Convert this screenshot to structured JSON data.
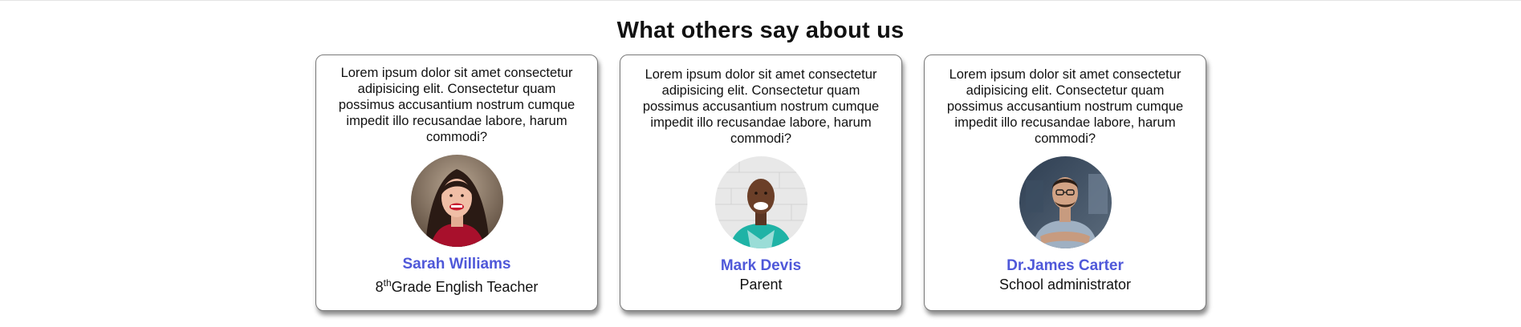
{
  "section": {
    "heading": "What others say about us"
  },
  "testimonials": [
    {
      "quote": "Lorem ipsum dolor sit amet consectetur adipisicing elit. Consectetur quam possimus accusantium nostrum cumque impedit illo recusandae labore, harum commodi?",
      "name": "Sarah Williams",
      "role_prefix": "8",
      "role_sup": "th",
      "role_suffix": "Grade English Teacher",
      "avatar_icon": "woman-portrait-avatar"
    },
    {
      "quote": "Lorem ipsum dolor sit amet consectetur adipisicing elit. Consectetur quam possimus accusantium nostrum cumque impedit illo recusandae labore, harum commodi?",
      "name": "Mark Devis",
      "role": "Parent",
      "avatar_icon": "man-portrait-avatar"
    },
    {
      "quote": "Lorem ipsum dolor sit amet consectetur adipisicing elit. Consectetur quam possimus accusantium nostrum cumque impedit illo recusandae labore, harum commodi?",
      "name": "Dr.James Carter",
      "role": "School administrator",
      "avatar_icon": "man-portrait-avatar"
    }
  ],
  "colors": {
    "name_accent": "#4f58d9",
    "card_border": "#7a7a7a"
  }
}
